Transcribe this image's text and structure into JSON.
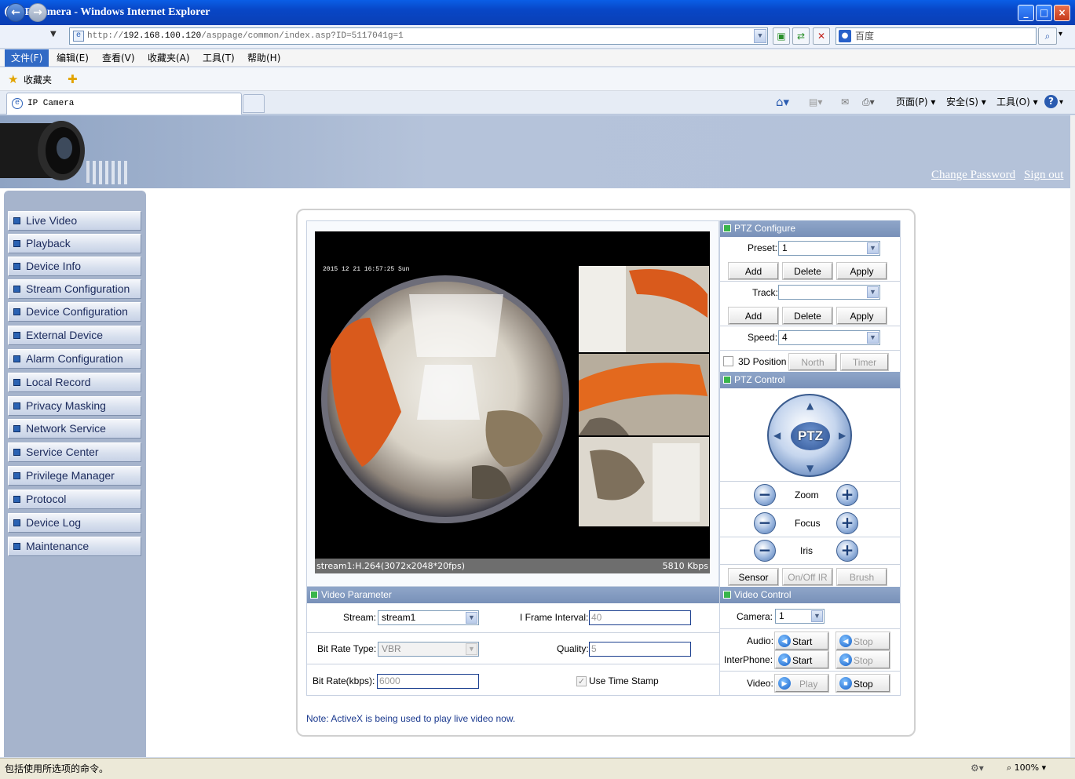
{
  "window": {
    "title": "IP Camera - Windows Internet Explorer",
    "ie_glyph": "e"
  },
  "address": {
    "url_prefix": "http://",
    "host": "192.168.100.120",
    "path": "/asppage/common/index.asp?ID=5117041g=1"
  },
  "search": {
    "placeholder": "百度"
  },
  "menu": [
    "文件(F)",
    "编辑(E)",
    "查看(V)",
    "收藏夹(A)",
    "工具(T)",
    "帮助(H)"
  ],
  "favorites": {
    "label": "收藏夹"
  },
  "tab": {
    "title": "IP Camera"
  },
  "toolbar": {
    "page": "页面(P)",
    "safety": "安全(S)",
    "tools": "工具(O)",
    "help": "?"
  },
  "header_links": {
    "change_password": "Change Password",
    "sign_out": "Sign out"
  },
  "sidebar": {
    "items": [
      {
        "label": "Live Video"
      },
      {
        "label": "Playback"
      },
      {
        "label": "Device Info"
      },
      {
        "label": "Stream Configuration"
      },
      {
        "label": "Device Configuration"
      },
      {
        "label": "External Device"
      },
      {
        "label": "Alarm Configuration"
      },
      {
        "label": "Local Record"
      },
      {
        "label": "Privacy Masking"
      },
      {
        "label": "Network Service"
      },
      {
        "label": "Service Center"
      },
      {
        "label": "Privilege Manager"
      },
      {
        "label": "Protocol"
      },
      {
        "label": "Device Log"
      },
      {
        "label": "Maintenance"
      }
    ]
  },
  "video": {
    "timestamp": "2015 12 21 16:57:25 Sun",
    "status_left": "stream1:H.264(3072x2048*20fps)",
    "status_right": "5810 Kbps"
  },
  "ptz_configure": {
    "title": "PTZ Configure",
    "preset_label": "Preset:",
    "preset_value": "1",
    "track_label": "Track:",
    "track_value": "",
    "speed_label": "Speed:",
    "speed_value": "4",
    "add": "Add",
    "delete": "Delete",
    "apply": "Apply",
    "position_3d": "3D Position",
    "north": "North",
    "timer": "Timer"
  },
  "ptz_control": {
    "title": "PTZ Control",
    "joystick": "PTZ",
    "zoom": "Zoom",
    "focus": "Focus",
    "iris": "Iris",
    "minus": "−",
    "plus": "+",
    "sensor": "Sensor",
    "onoff_ir": "On/Off IR",
    "brush": "Brush"
  },
  "video_parameter": {
    "title": "Video Parameter",
    "stream_label": "Stream:",
    "stream_value": "stream1",
    "iframe_label": "I Frame Interval:",
    "iframe_value": "40",
    "bitrate_type_label": "Bit Rate Type:",
    "bitrate_type_value": "VBR",
    "quality_label": "Quality:",
    "quality_value": "5",
    "bitrate_label": "Bit Rate(kbps):",
    "bitrate_value": "6000",
    "timestamp_label": "Use Time Stamp",
    "timestamp_checked": true
  },
  "video_control": {
    "title": "Video Control",
    "camera_label": "Camera:",
    "camera_value": "1",
    "audio_label": "Audio:",
    "interphone_label": "InterPhone:",
    "video_label": "Video:",
    "start": "Start",
    "stop": "Stop",
    "play": "Play"
  },
  "note": "Note: ActiveX is being used to play live video now.",
  "statusbar": {
    "text": "包括使用所选项的命令。",
    "zoom": "100%"
  },
  "colors": {
    "accent": "#316ac5",
    "sidebar_bg": "#a6b4cc",
    "section_head": "#8fa6c9"
  }
}
